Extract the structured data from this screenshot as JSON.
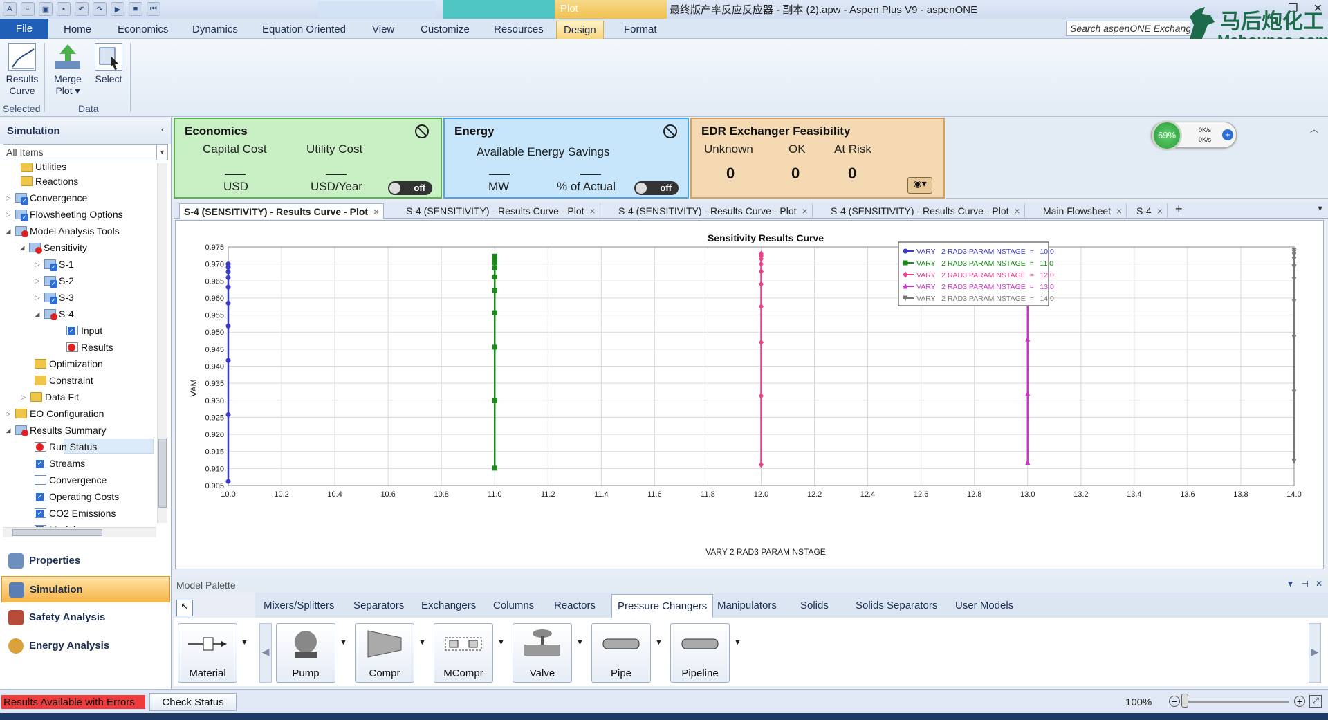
{
  "window": {
    "title": "最终版产率反应反应器 - 副本 (2).apw - Aspen Plus V9 - aspenONE",
    "context_tab": "Plot"
  },
  "ribbon": {
    "tabs": [
      "File",
      "Home",
      "Economics",
      "Dynamics",
      "Equation Oriented",
      "View",
      "Customize",
      "Resources",
      "Design",
      "Format"
    ],
    "active_tab": "Design",
    "search_placeholder": "Search aspenONE Exchange",
    "buttons": {
      "results_curve": "Results Curve",
      "merge_plot": "Merge Plot",
      "select": "Select"
    },
    "groups": {
      "selected": "Selected",
      "data": "Data"
    }
  },
  "logo": {
    "cn": "马后炮化工",
    "en": "Mahoupao.com"
  },
  "nav": {
    "header": "Simulation",
    "filter": "All Items",
    "tree": [
      {
        "label": "Utilities"
      },
      {
        "label": "Reactions"
      },
      {
        "label": "Convergence"
      },
      {
        "label": "Flowsheeting Options"
      },
      {
        "label": "Model Analysis Tools"
      },
      {
        "label": "Sensitivity"
      },
      {
        "label": "S-1"
      },
      {
        "label": "S-2"
      },
      {
        "label": "S-3"
      },
      {
        "label": "S-4"
      },
      {
        "label": "Input"
      },
      {
        "label": "Results"
      },
      {
        "label": "Optimization"
      },
      {
        "label": "Constraint"
      },
      {
        "label": "Data Fit"
      },
      {
        "label": "EO Configuration"
      },
      {
        "label": "Results Summary"
      },
      {
        "label": "Run Status"
      },
      {
        "label": "Streams"
      },
      {
        "label": "Convergence"
      },
      {
        "label": "Operating Costs"
      },
      {
        "label": "CO2 Emissions"
      },
      {
        "label": "Models"
      }
    ],
    "buttons": [
      "Properties",
      "Simulation",
      "Safety Analysis",
      "Energy Analysis"
    ],
    "active_button": "Simulation"
  },
  "dashboard": {
    "economics": {
      "title": "Economics",
      "capital_cost": "Capital Cost",
      "utility_cost": "Utility Cost",
      "unit1": "USD",
      "unit2": "USD/Year",
      "toggle": "off"
    },
    "energy": {
      "title": "Energy",
      "savings": "Available Energy Savings",
      "unit1": "MW",
      "unit2": "% of Actual",
      "toggle": "off"
    },
    "edr": {
      "title": "EDR Exchanger Feasibility",
      "unknown_label": "Unknown",
      "ok_label": "OK",
      "risk_label": "At Risk",
      "unknown": "0",
      "ok": "0",
      "risk": "0"
    },
    "gauge": {
      "percent": "69%",
      "up": "0K/s",
      "down": "0K/s"
    }
  },
  "doc_tabs": [
    {
      "label": "S-4 (SENSITIVITY) - Results Curve - Plot",
      "active": true
    },
    {
      "label": "S-4 (SENSITIVITY) - Results Curve - Plot"
    },
    {
      "label": "S-4 (SENSITIVITY) - Results Curve - Plot"
    },
    {
      "label": "S-4 (SENSITIVITY) - Results Curve - Plot"
    },
    {
      "label": "Main Flowsheet"
    },
    {
      "label": "S-4"
    }
  ],
  "chart_data": {
    "type": "scatter",
    "title": "Sensitivity Results Curve",
    "xlabel": "VARY   2 RAD3 PARAM NSTAGE",
    "ylabel": "VAM",
    "xlim": [
      10.0,
      14.0
    ],
    "ylim": [
      0.905,
      0.975
    ],
    "x_ticks": [
      "10.0",
      "10.2",
      "10.4",
      "10.6",
      "10.8",
      "11.0",
      "11.2",
      "11.4",
      "11.6",
      "11.8",
      "12.0",
      "12.2",
      "12.4",
      "12.6",
      "12.8",
      "13.0",
      "13.2",
      "13.4",
      "13.6",
      "13.8",
      "14.0"
    ],
    "y_ticks": [
      "0.905",
      "0.910",
      "0.915",
      "0.920",
      "0.925",
      "0.930",
      "0.935",
      "0.940",
      "0.945",
      "0.950",
      "0.955",
      "0.960",
      "0.965",
      "0.970",
      "0.975"
    ],
    "grid": true,
    "legend_position": "top-right",
    "series": [
      {
        "name": "VARY   2 RAD3 PARAM NSTAGE  =   10.0",
        "color": "#3b3bc8",
        "marker": "circle",
        "x": 10.0,
        "y": [
          0.9062,
          0.9258,
          0.9417,
          0.9518,
          0.9585,
          0.9632,
          0.966,
          0.9677,
          0.969,
          0.97
        ]
      },
      {
        "name": "VARY   2 RAD3 PARAM NSTAGE  =   11.0",
        "color": "#1a8a1a",
        "marker": "square",
        "x": 11.0,
        "y": [
          0.9101,
          0.9299,
          0.9456,
          0.9557,
          0.9623,
          0.9662,
          0.9688,
          0.9703,
          0.9713,
          0.9723
        ]
      },
      {
        "name": "VARY   2 RAD3 PARAM NSTAGE  =   12.0",
        "color": "#e8408a",
        "marker": "diamond",
        "x": 12.0,
        "y": [
          0.9111,
          0.9313,
          0.947,
          0.9575,
          0.9641,
          0.9678,
          0.97,
          0.9715,
          0.9724,
          0.973
        ]
      },
      {
        "name": "VARY   2 RAD3 PARAM NSTAGE  =   13.0",
        "color": "#c836c8",
        "marker": "triangle",
        "x": 13.0,
        "y": [
          0.9118,
          0.932,
          0.948,
          0.9585,
          0.9649,
          0.9687,
          0.9709,
          0.9722,
          0.973,
          0.9735
        ]
      },
      {
        "name": "VARY   2 RAD3 PARAM NSTAGE  =   14.0",
        "color": "#777777",
        "marker": "triangle-down",
        "x": 14.0,
        "y": [
          0.9121,
          0.9324,
          0.9485,
          0.959,
          0.9655,
          0.9692,
          0.9714,
          0.9727,
          0.9735,
          0.974
        ]
      }
    ]
  },
  "palette": {
    "title": "Model Palette",
    "tabs": [
      "Mixers/Splitters",
      "Separators",
      "Exchangers",
      "Columns",
      "Reactors",
      "Pressure Changers",
      "Manipulators",
      "Solids",
      "Solids Separators",
      "User Models"
    ],
    "active_tab": "Pressure Changers",
    "items": [
      "Material",
      "Pump",
      "Compr",
      "MCompr",
      "Valve",
      "Pipe",
      "Pipeline"
    ]
  },
  "status": {
    "message": "Results Available with Errors",
    "check_button": "Check Status",
    "zoom": "100%",
    "error_color": "#ee3b3b"
  }
}
